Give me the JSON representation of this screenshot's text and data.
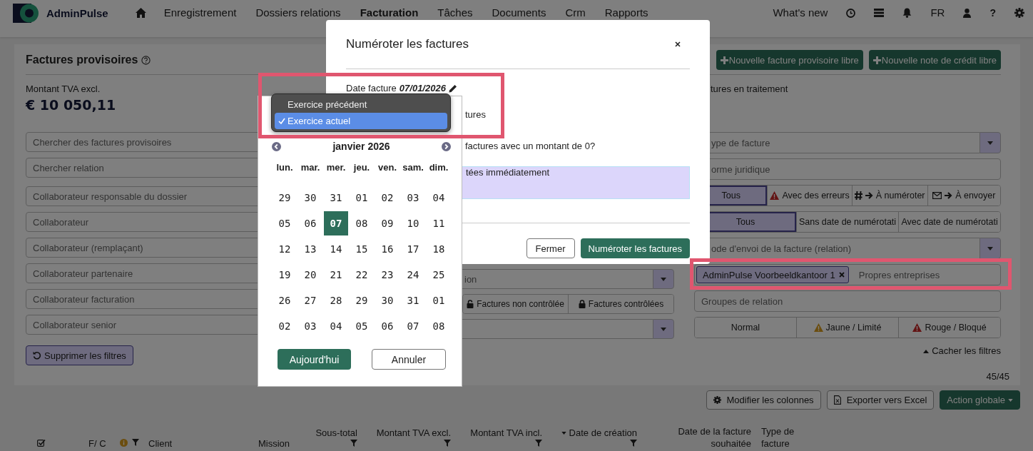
{
  "nav": {
    "brand": "AdminPulse",
    "links": [
      {
        "label": "Enregistrement",
        "selected": false
      },
      {
        "label": "Dossiers relations",
        "selected": false
      },
      {
        "label": "Facturation",
        "selected": true
      },
      {
        "label": "Tâches",
        "selected": false
      },
      {
        "label": "Documents",
        "selected": false
      },
      {
        "label": "Crm",
        "selected": false
      },
      {
        "label": "Rapports",
        "selected": false
      }
    ],
    "whats_new": "What's new",
    "language": "FR",
    "help": "?"
  },
  "panel": {
    "title": "Factures provisoires",
    "amount_label": "Montant TVA excl.",
    "amount": "€ 10 050,11",
    "left_filters": [
      {
        "placeholder": "Chercher des factures provisoires"
      },
      {
        "placeholder": "Chercher relation"
      },
      {
        "placeholder": "Collaborateur responsable du dossier"
      },
      {
        "placeholder": "Collaborateur"
      },
      {
        "placeholder": "Collaborateur (remplaçant)"
      },
      {
        "placeholder": "Collaborateur partenaire"
      },
      {
        "placeholder": "Collaborateur facturation"
      },
      {
        "placeholder": "Collaborateur senior"
      }
    ],
    "clear_filters": "Supprimer les filtres",
    "middle_filters": [
      {
        "kind": "select",
        "placeholder": "ion"
      },
      {
        "kind": "segmented",
        "options": [
          {
            "kind": "unchecked",
            "label": "Factures non contrôlée",
            "selected": false
          },
          {
            "kind": "checked",
            "label": "Factures contrôlées",
            "selected": false
          }
        ]
      },
      {
        "kind": "select"
      }
    ],
    "actions": [
      "Nouvelle facture provisoire libre",
      "Nouvelle note de crédit libre"
    ],
    "status_label": "tures en traitement",
    "right_filters": [
      {
        "kind": "select",
        "placeholder": "ype de facture"
      },
      {
        "kind": "input",
        "placeholder": "orme juridique"
      },
      {
        "kind": "segmented",
        "options": [
          {
            "kind": "plain",
            "label": "Tous",
            "selected": true
          },
          {
            "kind": "errors",
            "label": "Avec des erreurs",
            "selected": false
          },
          {
            "kind": "to_number",
            "label": "À numéroter",
            "selected": false
          },
          {
            "kind": "to_send",
            "label": "À envoyer",
            "selected": false
          }
        ]
      },
      {
        "kind": "segmented",
        "options": [
          {
            "kind": "plain",
            "label": "Tous",
            "selected": true
          },
          {
            "kind": "plain",
            "label": "Sans date de numérotati",
            "selected": false
          },
          {
            "kind": "plain",
            "label": "Avec date de numérotati",
            "selected": false
          }
        ]
      },
      {
        "kind": "select",
        "placeholder": "ode d'envoi de la facture (relation)"
      },
      {
        "kind": "tags",
        "tags": [
          "AdminPulse Voorbeeldkantoor 1"
        ],
        "placeholder": "Propres entreprises"
      },
      {
        "kind": "input",
        "placeholder": "Groupes de relation"
      },
      {
        "kind": "segmented",
        "options": [
          {
            "kind": "plain",
            "label": "Normal",
            "selected": false
          },
          {
            "kind": "limited",
            "label": "Jaune / Limité",
            "selected": false
          },
          {
            "kind": "blocked",
            "label": "Rouge / Bloqué",
            "selected": false
          }
        ]
      }
    ],
    "hide_filters": "Cacher les filtres",
    "count": "45/45"
  },
  "toolbar": [
    {
      "kind": "columns",
      "label": "Modifier les colonnes"
    },
    {
      "kind": "export",
      "label": "Exporter vers Excel"
    },
    {
      "kind": "menu",
      "label": "Action globale"
    }
  ],
  "table": {
    "columns": [
      {
        "kind": "select_all"
      },
      {
        "kind": "text",
        "label": "F/ C",
        "filter": false,
        "sorted": false
      },
      {
        "kind": "info_filter"
      },
      {
        "kind": "text",
        "label": "Client",
        "filter": false,
        "sorted": false
      },
      {
        "kind": "text",
        "label": "Mission",
        "filter": false,
        "sorted": false
      },
      {
        "kind": "text",
        "label": "Sous-total",
        "filter": true,
        "sorted": false
      },
      {
        "kind": "text",
        "label": "Montant TVA excl.",
        "filter": true,
        "sorted": false
      },
      {
        "kind": "text",
        "label": "Montant TVA incl.",
        "filter": true,
        "sorted": false
      },
      {
        "kind": "text",
        "label": "Date de création",
        "filter": true,
        "sorted": true
      },
      {
        "kind": "text",
        "label": "Date de la facture souhaitée",
        "filter": false,
        "sorted": false
      },
      {
        "kind": "text",
        "label": "Type de facture",
        "filter": false,
        "sorted": false
      }
    ]
  },
  "modal": {
    "title": "Numéroter les factures",
    "date_label": "Date facture",
    "date_value": "07/01/2026",
    "option_text": "tures",
    "question_text": "factures avec un montant de 0?",
    "info_text": "tées immédiatement",
    "buttons": [
      {
        "kind": "secondary",
        "label": "Fermer"
      },
      {
        "kind": "primary",
        "label": "Numéroter les factures"
      }
    ]
  },
  "calendar": {
    "month": "janvier 2026",
    "weekdays": [
      "lun.",
      "mar.",
      "mer.",
      "jeu.",
      "ven.",
      "sam.",
      "dim."
    ],
    "weeks": [
      [
        {
          "day": "29",
          "selected": false
        },
        {
          "day": "30",
          "selected": false
        },
        {
          "day": "31",
          "selected": false
        },
        {
          "day": "01",
          "selected": false
        },
        {
          "day": "02",
          "selected": false
        },
        {
          "day": "03",
          "selected": false
        },
        {
          "day": "04",
          "selected": false
        }
      ],
      [
        {
          "day": "05",
          "selected": false
        },
        {
          "day": "06",
          "selected": false
        },
        {
          "day": "07",
          "selected": true
        },
        {
          "day": "08",
          "selected": false
        },
        {
          "day": "09",
          "selected": false
        },
        {
          "day": "10",
          "selected": false
        },
        {
          "day": "11",
          "selected": false
        }
      ],
      [
        {
          "day": "12",
          "selected": false
        },
        {
          "day": "13",
          "selected": false
        },
        {
          "day": "14",
          "selected": false
        },
        {
          "day": "15",
          "selected": false
        },
        {
          "day": "16",
          "selected": false
        },
        {
          "day": "17",
          "selected": false
        },
        {
          "day": "18",
          "selected": false
        }
      ],
      [
        {
          "day": "19",
          "selected": false
        },
        {
          "day": "20",
          "selected": false
        },
        {
          "day": "21",
          "selected": false
        },
        {
          "day": "22",
          "selected": false
        },
        {
          "day": "23",
          "selected": false
        },
        {
          "day": "24",
          "selected": false
        },
        {
          "day": "25",
          "selected": false
        }
      ],
      [
        {
          "day": "26",
          "selected": false
        },
        {
          "day": "27",
          "selected": false
        },
        {
          "day": "28",
          "selected": false
        },
        {
          "day": "29",
          "selected": false
        },
        {
          "day": "30",
          "selected": false
        },
        {
          "day": "31",
          "selected": false
        },
        {
          "day": "01",
          "selected": false
        }
      ],
      [
        {
          "day": "02",
          "selected": false
        },
        {
          "day": "03",
          "selected": false
        },
        {
          "day": "04",
          "selected": false
        },
        {
          "day": "05",
          "selected": false
        },
        {
          "day": "06",
          "selected": false
        },
        {
          "day": "07",
          "selected": false
        },
        {
          "day": "08",
          "selected": false
        }
      ]
    ],
    "buttons": [
      {
        "kind": "primary",
        "label": "Aujourd'hui"
      },
      {
        "kind": "secondary",
        "label": "Annuler"
      }
    ]
  },
  "year_menu": {
    "items": [
      {
        "label": "Exercice précédent",
        "selected": false
      },
      {
        "label": "Exercice actuel",
        "selected": true
      }
    ]
  }
}
